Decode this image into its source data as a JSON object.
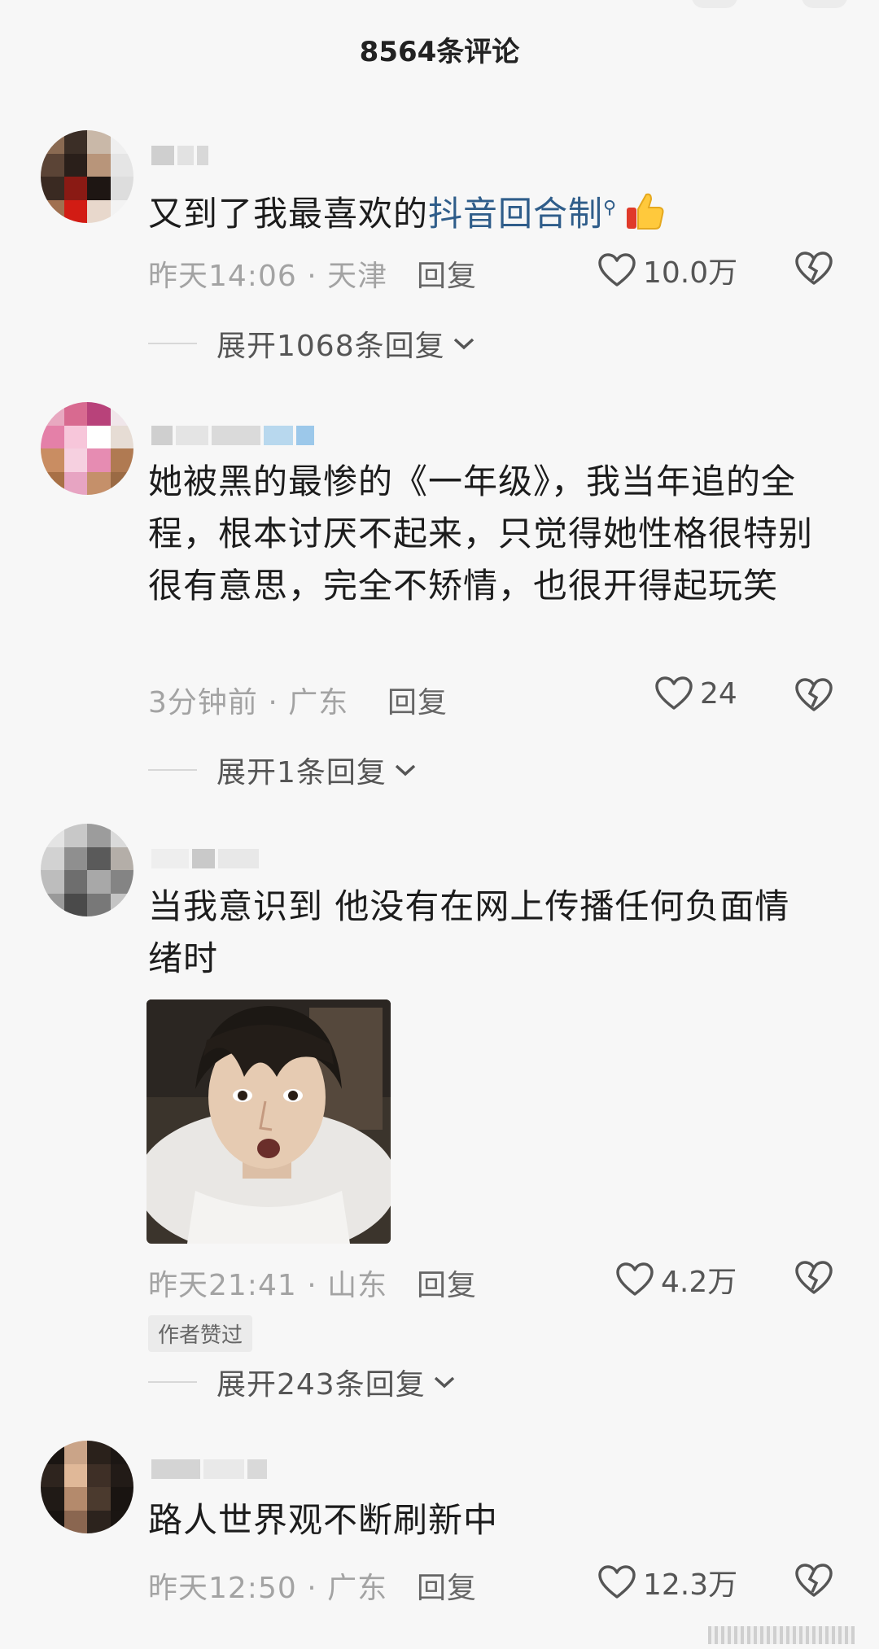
{
  "header": {
    "title": "8564条评论"
  },
  "comments": [
    {
      "text_plain": "又到了我最喜欢的",
      "text_link": "抖音回合制",
      "time": "昨天14:06 · 天津",
      "reply": "回复",
      "likes": "10.0万",
      "expand": "展开1068条回复"
    },
    {
      "text": "她被黑的最惨的《一年级》，我当年追的全程，根本讨厌不起来，只觉得她性格很特别很有意思，完全不矫情，也很开得起玩笑",
      "time": "3分钟前 · 广东",
      "reply": "回复",
      "likes": "24",
      "expand": "展开1条回复"
    },
    {
      "text": "当我意识到 他没有在网上传播任何负面情绪时",
      "time": "昨天21:41 · 山东",
      "reply": "回复",
      "likes": "4.2万",
      "badge": "作者赞过",
      "expand": "展开243条回复"
    },
    {
      "text": "路人世界观不断刷新中",
      "time": "昨天12:50 · 广东",
      "reply": "回复",
      "likes": "12.3万"
    }
  ],
  "icons": {
    "like": "heart-outline-icon",
    "dislike": "broken-heart-icon",
    "expand": "chevron-down-icon",
    "search": "search-icon",
    "thumb": "thumbs-up-emoji"
  },
  "colors": {
    "link": "#2f5d8a",
    "meta": "#a3a3a3",
    "background": "#f7f7f7"
  }
}
